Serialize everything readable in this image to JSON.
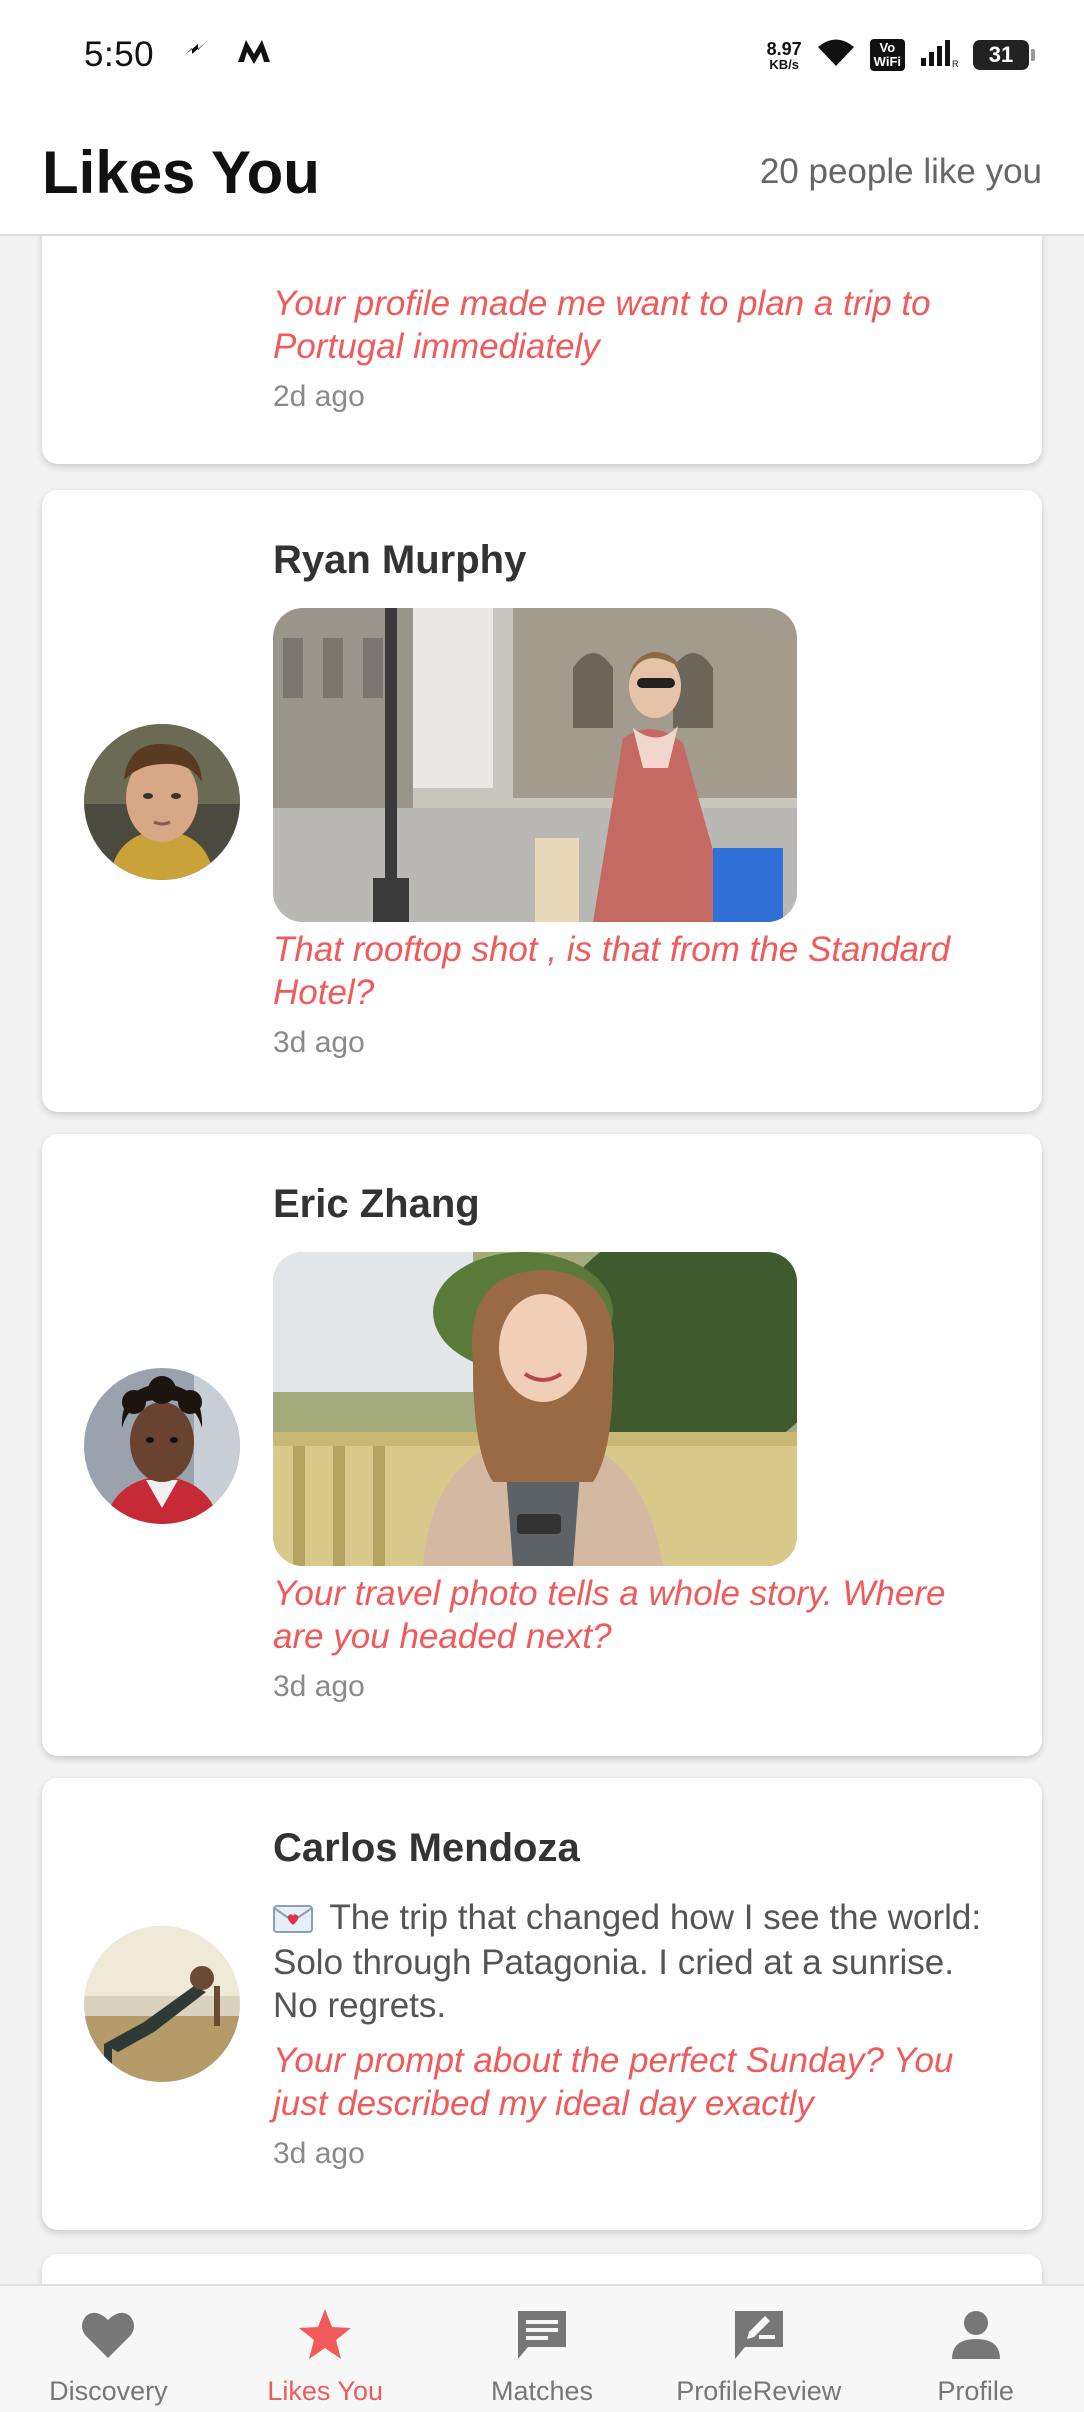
{
  "status_bar": {
    "time": "5:50",
    "speed_value": "8.97",
    "speed_unit": "KB/s",
    "vowifi_top": "Vo",
    "vowifi_bottom": "WiFi",
    "battery": "31"
  },
  "header": {
    "title": "Likes You",
    "count_text": "20 people like you"
  },
  "likes": [
    {
      "name": "",
      "message": "Your profile made me want to plan a trip to Portugal immediately",
      "time": "2d ago"
    },
    {
      "name": "Ryan Murphy",
      "photo": "woman-shopping-street-photo",
      "message": "That rooftop shot , is that from the Standard Hotel?",
      "time": "3d ago"
    },
    {
      "name": "Eric Zhang",
      "photo": "woman-smiling-phone-photo",
      "message": "Your travel photo tells a whole story. Where are you headed next?",
      "time": "3d ago"
    },
    {
      "name": "Carlos Mendoza",
      "prompt_icon": "love-letter-icon",
      "prompt": "The trip that changed how I see the world: Solo through Patagonia. I cried at a sunrise. No regrets.",
      "message": "Your prompt about the perfect Sunday? You just described my ideal day exactly",
      "time": "3d ago"
    }
  ],
  "tabs": [
    {
      "label": "Discovery",
      "icon": "heart-icon",
      "active": false
    },
    {
      "label": "Likes You",
      "icon": "star-icon",
      "active": true
    },
    {
      "label": "Matches",
      "icon": "chat-icon",
      "active": false
    },
    {
      "label": "ProfileReview",
      "icon": "rate-review-icon",
      "active": false
    },
    {
      "label": "Profile",
      "icon": "person-icon",
      "active": false
    }
  ],
  "colors": {
    "accent": "#f05a5a",
    "inactive_tab": "#777777",
    "background": "#f2f2f2"
  }
}
